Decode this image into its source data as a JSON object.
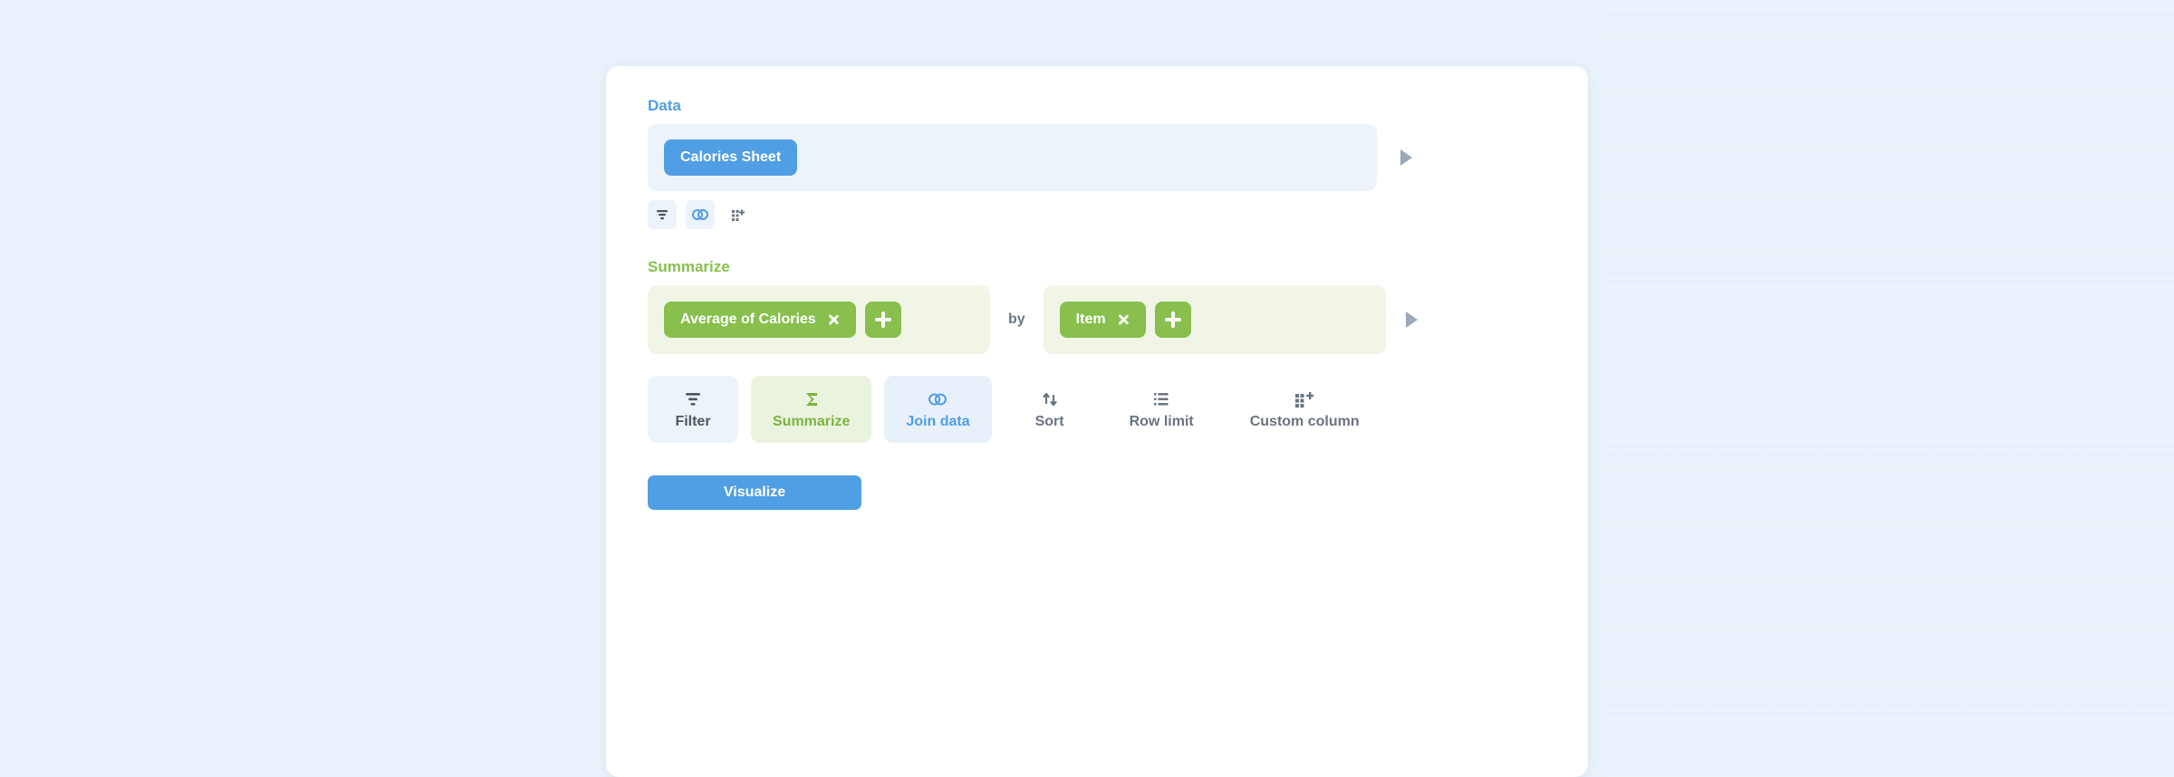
{
  "data_section": {
    "label": "Data",
    "source_pill": "Calories Sheet"
  },
  "summarize_section": {
    "label": "Summarize",
    "aggregation_pill": "Average of Calories",
    "by_label": "by",
    "group_pill": "Item"
  },
  "operations": {
    "filter": "Filter",
    "summarize": "Summarize",
    "join": "Join data",
    "sort": "Sort",
    "row_limit": "Row limit",
    "custom_column": "Custom column"
  },
  "visualize_button": "Visualize"
}
